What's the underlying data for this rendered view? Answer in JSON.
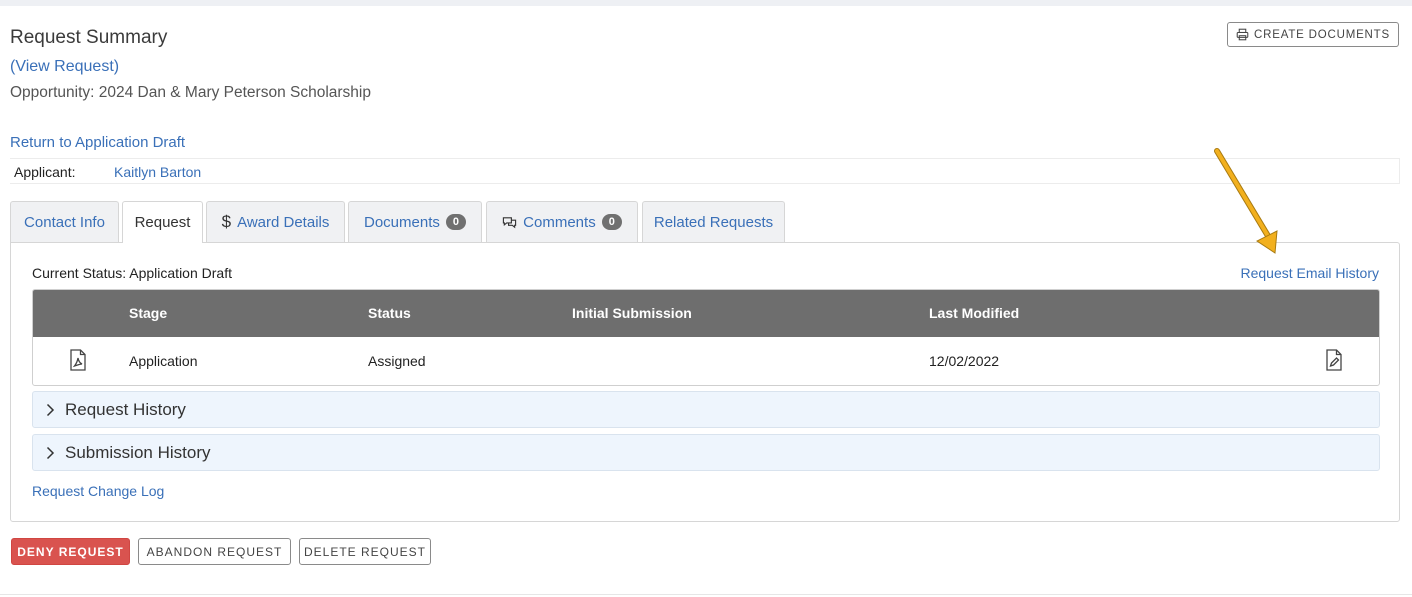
{
  "header": {
    "title": "Request Summary",
    "view_request": "(View Request)",
    "opportunity": "Opportunity: 2024 Dan & Mary Peterson Scholarship",
    "return_link": "Return to Application Draft",
    "create_documents": "CREATE DOCUMENTS"
  },
  "applicant": {
    "label": "Applicant:",
    "name": "Kaitlyn Barton"
  },
  "tabs": [
    {
      "label": "Contact Info"
    },
    {
      "label": "Request",
      "active": true
    },
    {
      "label": "Award Details",
      "icon": "dollar-icon"
    },
    {
      "label": "Documents",
      "badge": "0"
    },
    {
      "label": "Comments",
      "badge": "0",
      "icon": "comments-icon"
    },
    {
      "label": "Related Requests"
    }
  ],
  "panel": {
    "current_status": "Current Status: Application Draft",
    "email_history": "Request Email History",
    "table": {
      "headers": [
        "Stage",
        "Status",
        "Initial Submission",
        "Last Modified"
      ],
      "rows": [
        {
          "stage": "Application",
          "status": "Assigned",
          "initial_submission": "",
          "last_modified": "12/02/2022"
        }
      ]
    },
    "accordions": [
      "Request History",
      "Submission History"
    ],
    "change_log": "Request Change Log"
  },
  "actions": {
    "deny": "DENY REQUEST",
    "abandon": "ABANDON REQUEST",
    "delete": "DELETE REQUEST"
  },
  "colors": {
    "link": "#3a70b8",
    "deny": "#d9534f",
    "table_header": "#6e6e6e",
    "accordion_bg": "#eef5fd",
    "arrow": "#f2b01e"
  }
}
